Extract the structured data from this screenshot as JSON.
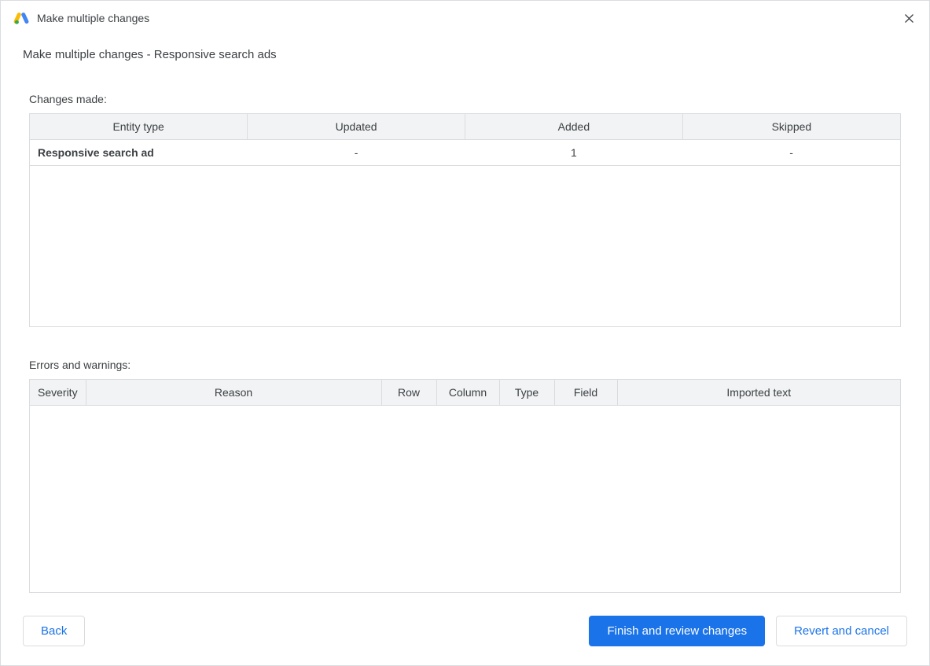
{
  "window": {
    "title": "Make multiple changes"
  },
  "subtitle": "Make multiple changes - Responsive search ads",
  "changes": {
    "label": "Changes made:",
    "headers": {
      "entity_type": "Entity type",
      "updated": "Updated",
      "added": "Added",
      "skipped": "Skipped"
    },
    "rows": [
      {
        "entity_type": "Responsive search ad",
        "updated": "-",
        "added": "1",
        "skipped": "-"
      }
    ]
  },
  "errors": {
    "label": "Errors and warnings:",
    "headers": {
      "severity": "Severity",
      "reason": "Reason",
      "row": "Row",
      "column": "Column",
      "type": "Type",
      "field": "Field",
      "imported_text": "Imported text"
    },
    "rows": []
  },
  "footer": {
    "back": "Back",
    "finish": "Finish and review changes",
    "revert": "Revert and cancel"
  }
}
